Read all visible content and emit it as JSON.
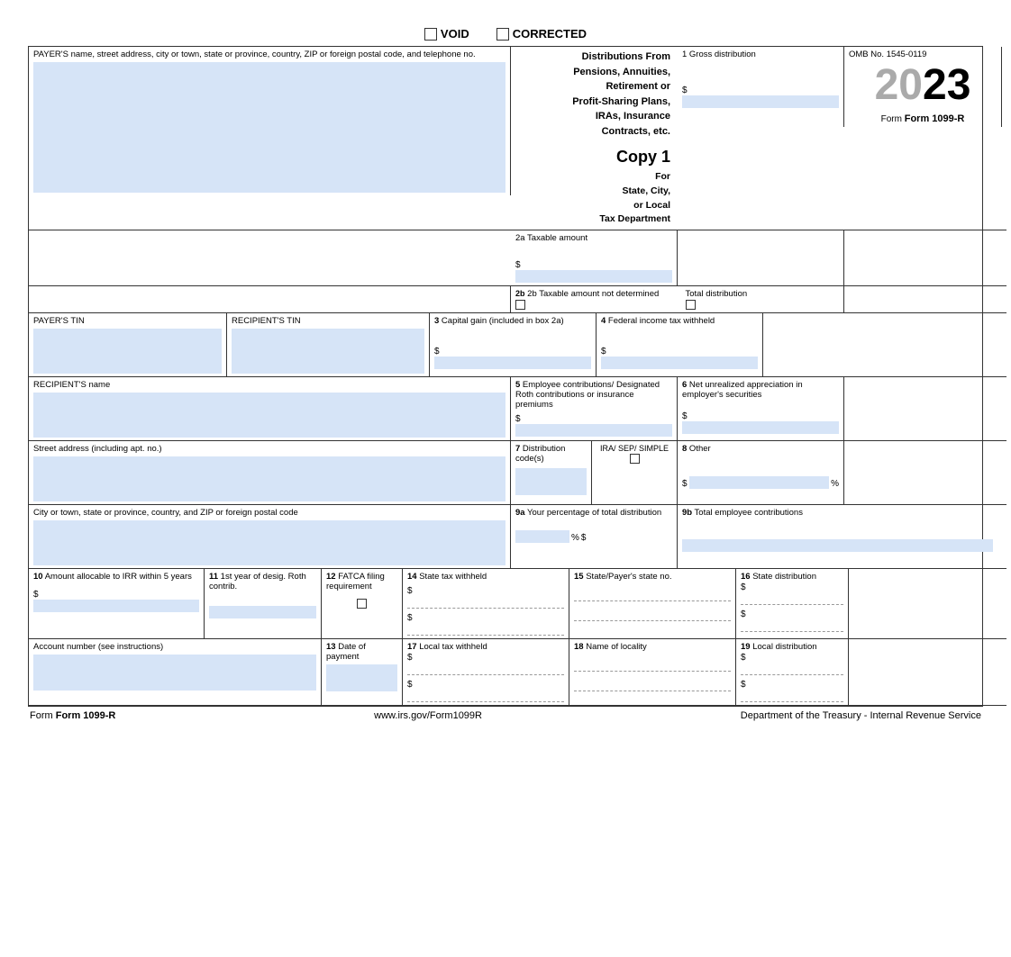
{
  "form": {
    "title": "Form 1099-R",
    "omb": "OMB No. 1545-0119",
    "year": "2023",
    "year_prefix": "20",
    "year_suffix": "23",
    "copy": "Copy 1",
    "for_label": "For\nState, City,\nor Local\nTax Department",
    "header_title": "Distributions From\nPensions, Annuities,\nRetirement or\nProfit-Sharing Plans,\nIRAs, Insurance\nContracts, etc.",
    "website": "www.irs.gov/Form1099R",
    "dept": "Department of the Treasury - Internal Revenue Service"
  },
  "checkboxes": {
    "void_label": "VOID",
    "corrected_label": "CORRECTED"
  },
  "boxes": {
    "payer_name_label": "PAYER'S name, street address, city or town, state or province, country, ZIP or foreign postal code, and telephone no.",
    "box1_label": "1  Gross distribution",
    "box1_dollar": "$",
    "box2a_label": "2a  Taxable amount",
    "box2a_dollar": "$",
    "box2b_label": "2b  Taxable amount not determined",
    "total_dist_label": "Total distribution",
    "box3_label": "3  Capital gain (included in box 2a)",
    "box3_dollar": "$",
    "box4_label": "4  Federal income tax withheld",
    "box4_dollar": "$",
    "payer_tin_label": "PAYER'S TIN",
    "recipient_tin_label": "RECIPIENT'S TIN",
    "recipient_name_label": "RECIPIENT'S name",
    "box5_label": "5  Employee contributions/ Designated Roth contributions or insurance premiums",
    "box5_dollar": "$",
    "box6_label": "6  Net unrealized appreciation in employer's securities",
    "box6_dollar": "$",
    "street_label": "Street address (including apt. no.)",
    "box7_label": "7  Distribution code(s)",
    "box7_ira_label": "IRA/ SEP/ SIMPLE",
    "box8_label": "8  Other",
    "box8_dollar": "$",
    "box8_percent": "%",
    "city_label": "City or town, state or province, country, and ZIP or foreign postal code",
    "box9a_label": "9a  Your percentage of total distribution",
    "box9a_percent": "%",
    "box9a_dollar": "$",
    "box9b_label": "9b  Total employee contributions",
    "box10_label": "10  Amount allocable to IRR within 5 years",
    "box10_dollar": "$",
    "box11_label": "11  1st year of desig. Roth contrib.",
    "box12_label": "12  FATCA filing requirement",
    "box13_label": "13  Date of payment",
    "box14_label": "14  State tax withheld",
    "box14_dollar1": "$",
    "box14_dollar2": "$",
    "box15_label": "15  State/Payer's state no.",
    "box16_label": "16  State distribution",
    "box16_dollar1": "$",
    "box16_dollar2": "$",
    "box17_label": "17  Local tax withheld",
    "box17_dollar1": "$",
    "box17_dollar2": "$",
    "box18_label": "18  Name of locality",
    "box19_label": "19  Local distribution",
    "box19_dollar1": "$",
    "box19_dollar2": "$",
    "account_label": "Account number (see instructions)"
  }
}
